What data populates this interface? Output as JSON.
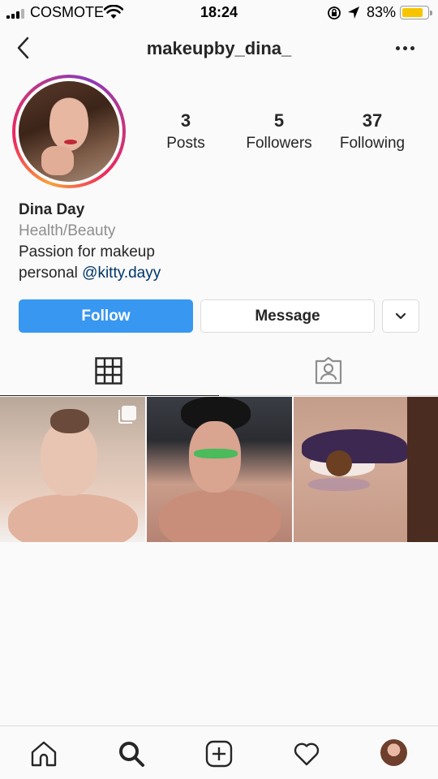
{
  "status_bar": {
    "carrier": "COSMOTE",
    "time": "18:24",
    "battery_percent_label": "83%",
    "battery_level": 0.83,
    "battery_color": "#f7c500"
  },
  "header": {
    "username": "makeupby_dina_",
    "back_icon": "chevron-left-icon",
    "more_icon": "more-horizontal-icon"
  },
  "profile": {
    "stats": [
      {
        "value": "3",
        "label": "Posts"
      },
      {
        "value": "5",
        "label": "Followers"
      },
      {
        "value": "37",
        "label": "Following"
      }
    ],
    "name": "Dina Day",
    "category": "Health/Beauty",
    "bio_line1": "Passion for makeup",
    "bio_line2_prefix": "personal ",
    "bio_mention": "@kitty.dayy"
  },
  "actions": {
    "follow_label": "Follow",
    "message_label": "Message",
    "follow_color": "#3897f0"
  },
  "tabs": [
    {
      "name": "grid",
      "icon": "grid-icon",
      "active": true
    },
    {
      "name": "tagged",
      "icon": "tagged-person-icon",
      "active": false
    }
  ],
  "posts": [
    {
      "index": 1,
      "multiple": true
    },
    {
      "index": 2,
      "multiple": false
    },
    {
      "index": 3,
      "multiple": false
    }
  ],
  "bottom_nav": [
    "home-icon",
    "search-icon",
    "new-post-icon",
    "activity-heart-icon",
    "profile-avatar"
  ]
}
